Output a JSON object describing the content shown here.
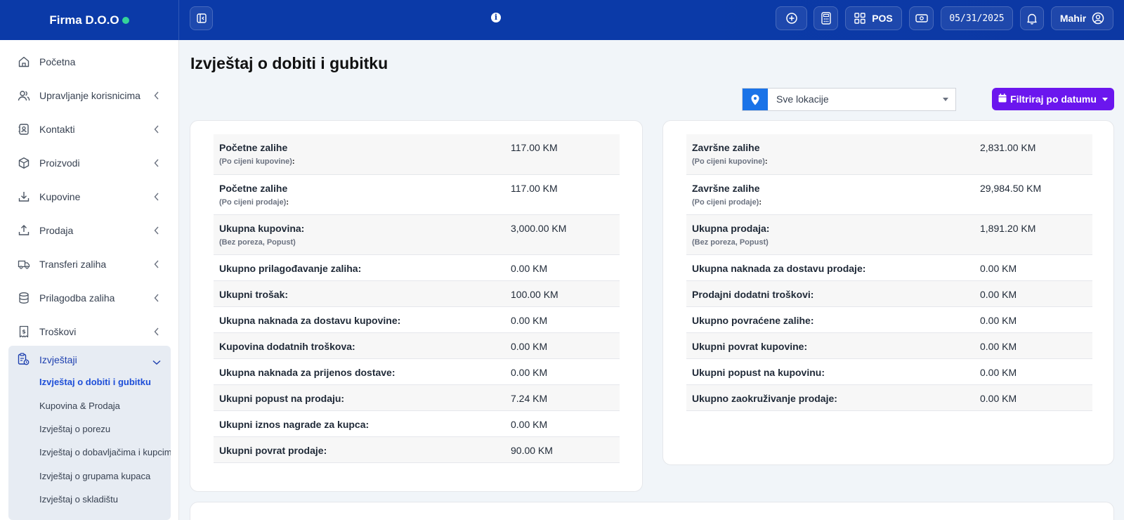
{
  "brand": {
    "name": "Firma D.O.O",
    "status_color": "#34d399"
  },
  "topbar": {
    "pos_label": "POS",
    "date": "05/31/2025",
    "user": "Mahir",
    "icons": [
      "sidebar-toggle-icon",
      "info-icon",
      "plus-circle-icon",
      "calculator-icon",
      "grid-icon",
      "cash-icon",
      "bell-icon",
      "user-circle-icon"
    ]
  },
  "sidebar": {
    "items": [
      {
        "label": "Početna",
        "icon": "home-icon"
      },
      {
        "label": "Upravljanje korisnicima",
        "icon": "users-icon"
      },
      {
        "label": "Kontakti",
        "icon": "contacts-icon"
      },
      {
        "label": "Proizvodi",
        "icon": "box-icon"
      },
      {
        "label": "Kupovine",
        "icon": "download-icon"
      },
      {
        "label": "Prodaja",
        "icon": "upload-icon"
      },
      {
        "label": "Transferi zaliha",
        "icon": "truck-icon"
      },
      {
        "label": "Prilagodba zaliha",
        "icon": "database-icon"
      },
      {
        "label": "Troškovi",
        "icon": "receipt-icon"
      }
    ],
    "reports": {
      "label": "Izvještaji",
      "sub_items": [
        "Izvještaj o dobiti i gubitku",
        "Kupovina & Prodaja",
        "Izvještaj o porezu",
        "Izvještaj o dobavljačima i kupcima",
        "Izvještaj o grupama kupaca",
        "Izvještaj o skladištu"
      ]
    }
  },
  "main": {
    "title": "Izvještaj o dobiti i gubitku",
    "location_select": "Sve lokacije",
    "filter_button": "Filtriraj po datumu",
    "accent_color": "#6b16ee",
    "left_rows": [
      {
        "label": "Početne zalihe",
        "sub": "(Po cijeni kupovine)",
        "sub_suffix": ":",
        "value": "117.00 KM"
      },
      {
        "label": "Početne zalihe",
        "sub": "(Po cijeni prodaje)",
        "sub_suffix": ":",
        "value": "117.00 KM"
      },
      {
        "label": "Ukupna kupovina:",
        "sub": "(Bez poreza, Popust)",
        "sub_suffix": "",
        "value": "3,000.00 KM"
      },
      {
        "label": "Ukupno prilagođavanje zaliha:",
        "value": "0.00 KM"
      },
      {
        "label": "Ukupni trošak:",
        "value": "100.00 KM"
      },
      {
        "label": "Ukupna naknada za dostavu kupovine:",
        "value": "0.00 KM"
      },
      {
        "label": "Kupovina dodatnih troškova:",
        "value": "0.00 KM"
      },
      {
        "label": "Ukupna naknada za prijenos dostave:",
        "value": "0.00 KM"
      },
      {
        "label": "Ukupni popust na prodaju:",
        "value": "7.24 KM"
      },
      {
        "label": "Ukupni iznos nagrade za kupca:",
        "value": "0.00 KM"
      },
      {
        "label": "Ukupni povrat prodaje:",
        "value": "90.00 KM"
      }
    ],
    "right_rows": [
      {
        "label": "Završne zalihe",
        "sub": "(Po cijeni kupovine)",
        "sub_suffix": ":",
        "value": "2,831.00 KM"
      },
      {
        "label": "Završne zalihe",
        "sub": "(Po cijeni prodaje)",
        "sub_suffix": ":",
        "value": "29,984.50 KM"
      },
      {
        "label": "Ukupna prodaja:",
        "sub": "(Bez poreza, Popust)",
        "sub_suffix": "",
        "value": "1,891.20 KM"
      },
      {
        "label": "Ukupna naknada za dostavu prodaje:",
        "value": "0.00 KM"
      },
      {
        "label": "Prodajni dodatni troškovi:",
        "value": "0.00 KM"
      },
      {
        "label": "Ukupno povraćene zalihe:",
        "value": "0.00 KM"
      },
      {
        "label": "Ukupni povrat kupovine:",
        "value": "0.00 KM"
      },
      {
        "label": "Ukupni popust na kupovinu:",
        "value": "0.00 KM"
      },
      {
        "label": "Ukupno zaokruživanje prodaje:",
        "value": "0.00 KM"
      }
    ]
  }
}
